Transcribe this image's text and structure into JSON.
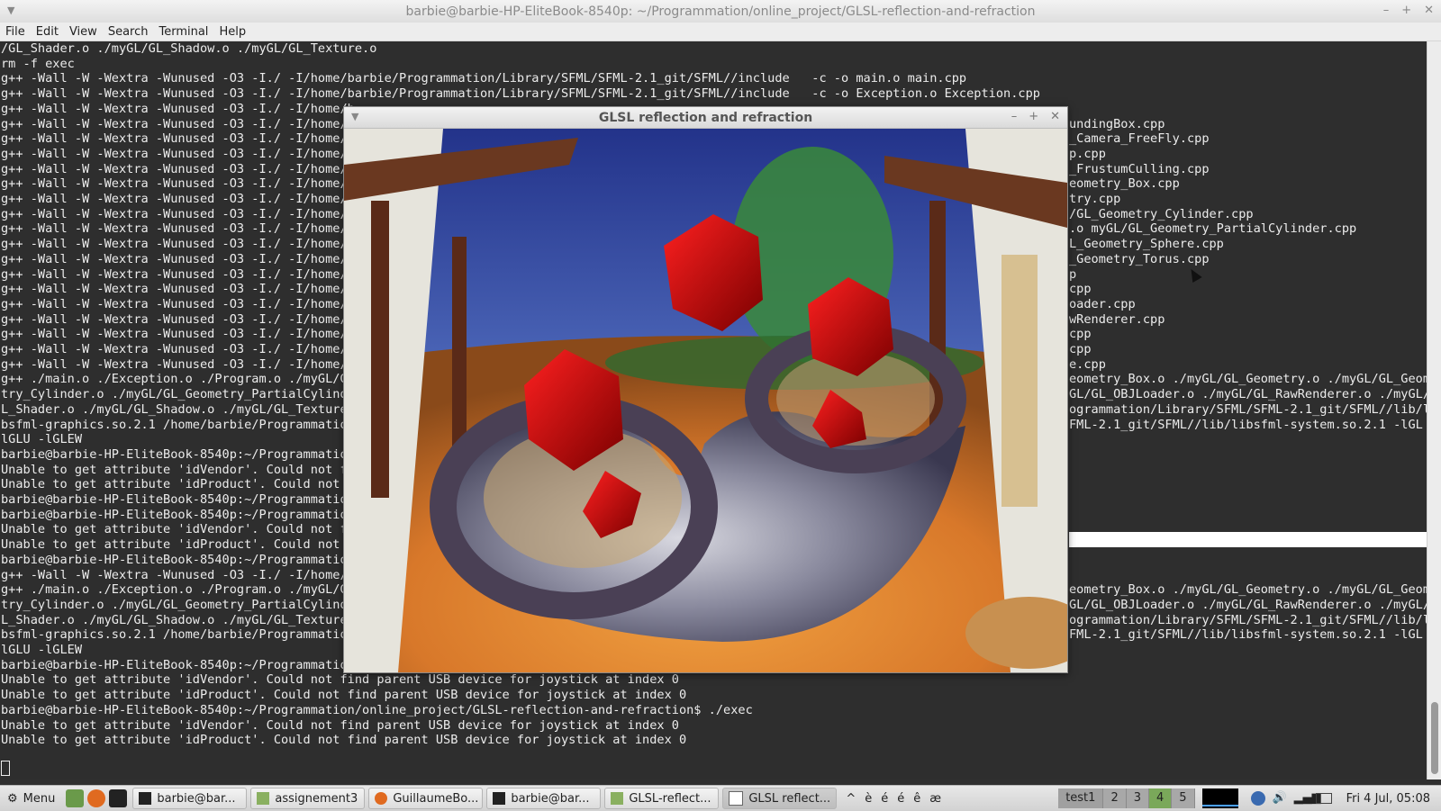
{
  "window": {
    "title": "barbie@barbie-HP-EliteBook-8540p: ~/Programmation/online_project/GLSL-reflection-and-refraction",
    "controls": [
      "–",
      "+",
      "✕"
    ]
  },
  "menubar": [
    "File",
    "Edit",
    "View",
    "Search",
    "Terminal",
    "Help"
  ],
  "terminal": {
    "lines": [
      "/GL_Shader.o ./myGL/GL_Shadow.o ./myGL/GL_Texture.o",
      "rm -f exec",
      "g++ -Wall -W -Wextra -Wunused -O3 -I./ -I/home/barbie/Programmation/Library/SFML/SFML-2.1_git/SFML//include   -c -o main.o main.cpp",
      "g++ -Wall -W -Wextra -Wunused -O3 -I./ -I/home/barbie/Programmation/Library/SFML/SFML-2.1_git/SFML//include   -c -o Exception.o Exception.cpp",
      "g++ -Wall -W -Wextra -Wunused -O3 -I./ -I/home/b",
      "g++ -Wall -W -Wextra -Wunused -O3 -I./ -I/home/b",
      "g++ -Wall -W -Wextra -Wunused -O3 -I./ -I/home/b",
      "g++ -Wall -W -Wextra -Wunused -O3 -I./ -I/home/b",
      "g++ -Wall -W -Wextra -Wunused -O3 -I./ -I/home/b",
      "g++ -Wall -W -Wextra -Wunused -O3 -I./ -I/home/b",
      "g++ -Wall -W -Wextra -Wunused -O3 -I./ -I/home/b",
      "g++ -Wall -W -Wextra -Wunused -O3 -I./ -I/home/b",
      "g++ -Wall -W -Wextra -Wunused -O3 -I./ -I/home/b",
      "g++ -Wall -W -Wextra -Wunused -O3 -I./ -I/home/b",
      "g++ -Wall -W -Wextra -Wunused -O3 -I./ -I/home/b",
      "g++ -Wall -W -Wextra -Wunused -O3 -I./ -I/home/b",
      "g++ -Wall -W -Wextra -Wunused -O3 -I./ -I/home/b",
      "g++ -Wall -W -Wextra -Wunused -O3 -I./ -I/home/b",
      "g++ -Wall -W -Wextra -Wunused -O3 -I./ -I/home/b",
      "g++ -Wall -W -Wextra -Wunused -O3 -I./ -I/home/b",
      "g++ -Wall -W -Wextra -Wunused -O3 -I./ -I/home/b",
      "g++ -Wall -W -Wextra -Wunused -O3 -I./ -I/home/b",
      "g++ ./main.o ./Exception.o ./Program.o ./myGL/Gl",
      "try_Cylinder.o ./myGL/GL_Geometry_PartialCylinde",
      "L_Shader.o ./myGL/GL_Shadow.o ./myGL/GL_Texture",
      "bsfml-graphics.so.2.1 /home/barbie/Programmation",
      "lGLU -lGLEW",
      "barbie@barbie-HP-EliteBook-8540p:~/Programmation",
      "Unable to get attribute 'idVendor'. Could not f",
      "Unable to get attribute 'idProduct'. Could not ",
      "barbie@barbie-HP-EliteBook-8540p:~/Programmation",
      "barbie@barbie-HP-EliteBook-8540p:~/Programmation",
      "Unable to get attribute 'idVendor'. Could not fi",
      "Unable to get attribute 'idProduct'. Could not ",
      "barbie@barbie-HP-EliteBook-8540p:~/Programmation",
      "g++ -Wall -W -Wextra -Wunused -O3 -I./ -I/home/b",
      "g++ ./main.o ./Exception.o ./Program.o ./myGL/Gl",
      "try_Cylinder.o ./myGL/GL_Geometry_PartialCylinde",
      "L_Shader.o ./myGL/GL_Shadow.o ./myGL/GL_Texture",
      "bsfml-graphics.so.2.1 /home/barbie/Programmation",
      "lGLU -lGLEW",
      "barbie@barbie-HP-EliteBook-8540p:~/Programmation/online_project/GLSL-reflection-and-refraction$ ./exec",
      "Unable to get attribute 'idVendor'. Could not find parent USB device for joystick at index 0",
      "Unable to get attribute 'idProduct'. Could not find parent USB device for joystick at index 0",
      "barbie@barbie-HP-EliteBook-8540p:~/Programmation/online_project/GLSL-reflection-and-refraction$ ./exec",
      "Unable to get attribute 'idVendor'. Could not find parent USB device for joystick at index 0",
      "Unable to get attribute 'idProduct'. Could not find parent USB device for joystick at index 0"
    ],
    "right_lines": [
      {
        "row": 5,
        "text": "undingBox.cpp"
      },
      {
        "row": 6,
        "text": "_Camera_FreeFly.cpp"
      },
      {
        "row": 7,
        "text": "p.cpp"
      },
      {
        "row": 8,
        "text": "_FrustumCulling.cpp"
      },
      {
        "row": 9,
        "text": "eometry_Box.cpp"
      },
      {
        "row": 10,
        "text": "try.cpp"
      },
      {
        "row": 11,
        "text": "/GL_Geometry_Cylinder.cpp"
      },
      {
        "row": 12,
        "text": ".o myGL/GL_Geometry_PartialCylinder.cpp"
      },
      {
        "row": 13,
        "text": "L_Geometry_Sphere.cpp"
      },
      {
        "row": 14,
        "text": "_Geometry_Torus.cpp"
      },
      {
        "row": 15,
        "text": "p"
      },
      {
        "row": 16,
        "text": "cpp"
      },
      {
        "row": 17,
        "text": "oader.cpp"
      },
      {
        "row": 18,
        "text": "wRenderer.cpp"
      },
      {
        "row": 19,
        "text": "cpp"
      },
      {
        "row": 20,
        "text": "cpp"
      },
      {
        "row": 21,
        "text": "e.cpp"
      },
      {
        "row": 22,
        "text": "eometry_Box.o ./myGL/GL_Geometry.o ./myGL/GL_Geome"
      },
      {
        "row": 23,
        "text": "GL/GL_OBJLoader.o ./myGL/GL_RawRenderer.o ./myGL/G"
      },
      {
        "row": 24,
        "text": "ogrammation/Library/SFML/SFML-2.1_git/SFML//lib/li"
      },
      {
        "row": 25,
        "text": "FML-2.1_git/SFML//lib/libsfml-system.so.2.1 -lGL -"
      },
      {
        "row": 36,
        "text": "eometry_Box.o ./myGL/GL_Geometry.o ./myGL/GL_Geome"
      },
      {
        "row": 37,
        "text": "GL/GL_OBJLoader.o ./myGL/GL_RawRenderer.o ./myGL/G"
      },
      {
        "row": 38,
        "text": "ogrammation/Library/SFML/SFML-2.1_git/SFML//lib/li"
      },
      {
        "row": 39,
        "text": "FML-2.1_git/SFML//lib/libsfml-system.so.2.1 -lGL -"
      }
    ]
  },
  "gl_window": {
    "title": "GLSL reflection and refraction",
    "controls": [
      "–",
      "+",
      "✕"
    ]
  },
  "taskbar": {
    "menu_label": "Menu",
    "tasks": [
      {
        "label": "barbie@bar...",
        "icon": "terminal-icon",
        "active": false
      },
      {
        "label": "assignement3",
        "icon": "folder-icon",
        "active": false
      },
      {
        "label": "GuillaumeBo...",
        "icon": "firefox-icon",
        "active": false
      },
      {
        "label": "barbie@bar...",
        "icon": "terminal-icon",
        "active": false
      },
      {
        "label": "GLSL-reflect...",
        "icon": "folder-icon",
        "active": false
      },
      {
        "label": "GLSL reflect...",
        "icon": "window-icon",
        "active": true
      }
    ],
    "special_chars": [
      "^",
      "è",
      "é",
      "é",
      "ê",
      "æ"
    ],
    "workspaces": [
      "test1",
      "2",
      "3",
      "4",
      "5"
    ],
    "active_workspace": "4",
    "clock": "Fri 4 Jul, 05:08"
  },
  "colors": {
    "terminal_bg": "#2e2e2e",
    "terminal_fg": "#ececec",
    "cube_red": "#c81010",
    "workspace_active": "#7aa85a"
  }
}
